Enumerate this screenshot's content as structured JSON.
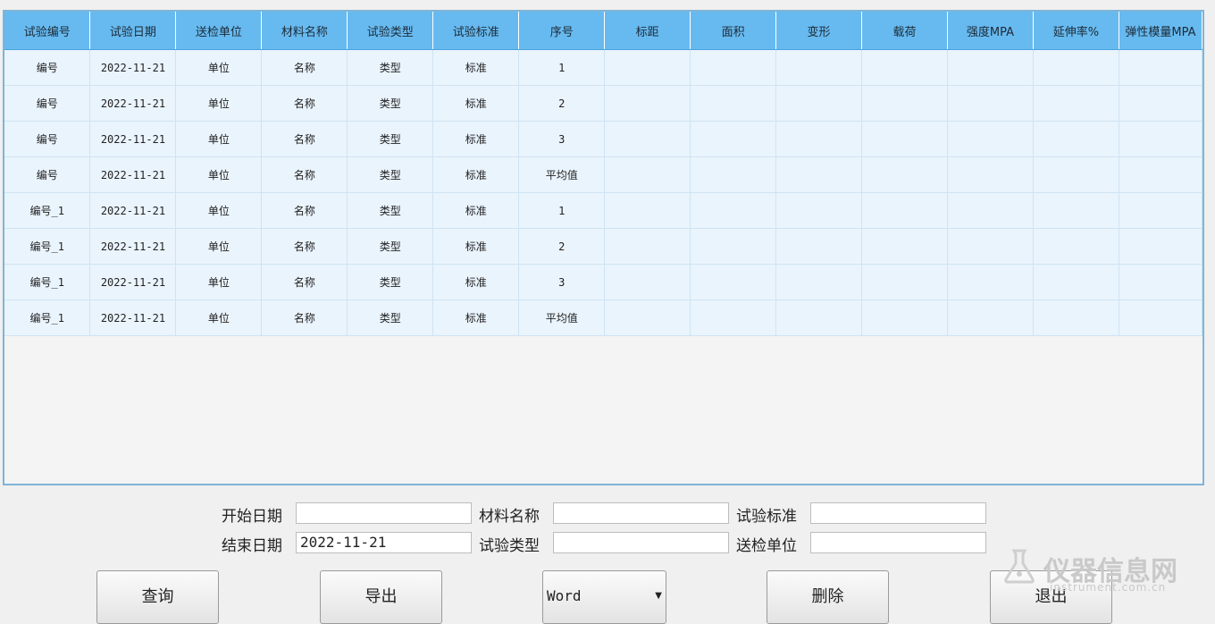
{
  "table": {
    "headers": [
      "试验编号",
      "试验日期",
      "送检单位",
      "材料名称",
      "试验类型",
      "试验标准",
      "序号",
      "标距",
      "面积",
      "变形",
      "载荷",
      "强度MPA",
      "延伸率%",
      "弹性模量MPA"
    ],
    "rows": [
      [
        "编号",
        "2022-11-21",
        "单位",
        "名称",
        "类型",
        "标准",
        "1",
        "",
        "",
        "",
        "",
        "",
        "",
        ""
      ],
      [
        "编号",
        "2022-11-21",
        "单位",
        "名称",
        "类型",
        "标准",
        "2",
        "",
        "",
        "",
        "",
        "",
        "",
        ""
      ],
      [
        "编号",
        "2022-11-21",
        "单位",
        "名称",
        "类型",
        "标准",
        "3",
        "",
        "",
        "",
        "",
        "",
        "",
        ""
      ],
      [
        "编号",
        "2022-11-21",
        "单位",
        "名称",
        "类型",
        "标准",
        "平均值",
        "",
        "",
        "",
        "",
        "",
        "",
        ""
      ],
      [
        "编号_1",
        "2022-11-21",
        "单位",
        "名称",
        "类型",
        "标准",
        "1",
        "",
        "",
        "",
        "",
        "",
        "",
        ""
      ],
      [
        "编号_1",
        "2022-11-21",
        "单位",
        "名称",
        "类型",
        "标准",
        "2",
        "",
        "",
        "",
        "",
        "",
        "",
        ""
      ],
      [
        "编号_1",
        "2022-11-21",
        "单位",
        "名称",
        "类型",
        "标准",
        "3",
        "",
        "",
        "",
        "",
        "",
        "",
        ""
      ],
      [
        "编号_1",
        "2022-11-21",
        "单位",
        "名称",
        "类型",
        "标准",
        "平均值",
        "",
        "",
        "",
        "",
        "",
        "",
        ""
      ]
    ]
  },
  "filters": {
    "start_date_label": "开始日期",
    "start_date_value": "",
    "end_date_label": "结束日期",
    "end_date_value": "2022-11-21",
    "material_label": "材料名称",
    "material_value": "",
    "test_type_label": "试验类型",
    "test_type_value": "",
    "standard_label": "试验标准",
    "standard_value": "",
    "unit_label": "送检单位",
    "unit_value": ""
  },
  "buttons": {
    "query": "查询",
    "export": "导出",
    "format_selected": "Word",
    "delete": "删除",
    "exit": "退出"
  },
  "watermark": {
    "text": "仪器信息网",
    "url": "instrument.com.cn"
  },
  "colors": {
    "header_bg": "#67baf0",
    "row_bg": "#eaf4fd",
    "border": "#7fb4d6"
  }
}
